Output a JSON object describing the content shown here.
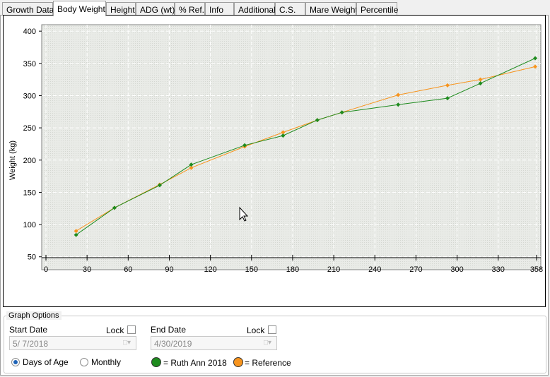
{
  "tabs": [
    {
      "label": "Growth Data",
      "active": false
    },
    {
      "label": "Body Weight",
      "active": true
    },
    {
      "label": "Height",
      "active": false
    },
    {
      "label": "ADG (wt)",
      "active": false
    },
    {
      "label": "% Ref.",
      "active": false
    },
    {
      "label": "Info",
      "active": false
    },
    {
      "label": "Additional",
      "active": false
    },
    {
      "label": "C.S.",
      "active": false
    },
    {
      "label": "Mare Weight",
      "active": false
    },
    {
      "label": "Percentile",
      "active": false
    }
  ],
  "chart_data": {
    "type": "line",
    "title": "",
    "xlabel": "",
    "ylabel": "Weight (kg)",
    "xlim": [
      0,
      358
    ],
    "ylim": [
      30,
      410
    ],
    "x_ticks": [
      0,
      30,
      60,
      90,
      120,
      150,
      180,
      210,
      240,
      270,
      300,
      330,
      358
    ],
    "y_ticks": [
      50,
      100,
      150,
      200,
      250,
      300,
      350,
      400
    ],
    "grid": true,
    "series": [
      {
        "name": "Ruth Ann 2018",
        "color": "#1e8b1e",
        "x": [
          22,
          50,
          83,
          106,
          145,
          173,
          198,
          216,
          257,
          293,
          317,
          357
        ],
        "y": [
          84,
          126,
          161,
          193,
          223,
          238,
          262,
          274,
          286,
          296,
          319,
          358
        ]
      },
      {
        "name": "Reference",
        "color": "#f7941d",
        "x": [
          22,
          50,
          83,
          106,
          145,
          173,
          198,
          216,
          257,
          293,
          317,
          357
        ],
        "y": [
          90,
          126,
          162,
          188,
          221,
          243,
          262,
          274,
          301,
          316,
          325,
          345
        ]
      }
    ]
  },
  "options": {
    "legend": "Graph Options",
    "start_label": "Start Date",
    "start_value": "5/  7/2018",
    "end_label": "End Date",
    "end_value": "4/30/2019",
    "lock_label": "Lock",
    "radio_days": "Days of Age",
    "radio_monthly": "Monthly",
    "legend_series1": "= Ruth Ann 2018",
    "legend_series2": "= Reference",
    "series1_color": "#1e8b1e",
    "series2_color": "#f7941d"
  }
}
